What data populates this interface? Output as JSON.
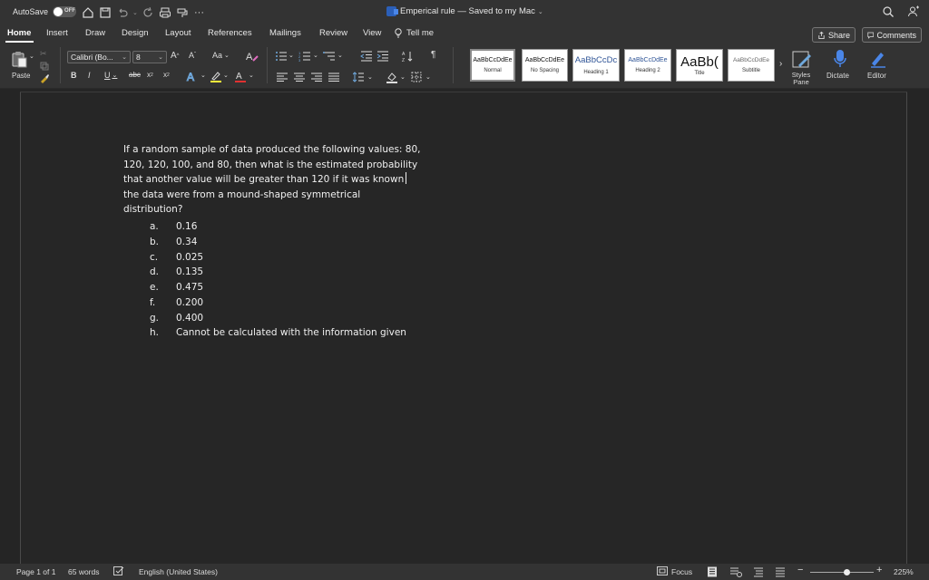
{
  "titlebar": {
    "autosave_label": "AutoSave",
    "autosave_state": "OFF",
    "doc_title": "Emperical rule",
    "doc_status": "— Saved to my Mac"
  },
  "tabs": [
    "Home",
    "Insert",
    "Draw",
    "Design",
    "Layout",
    "References",
    "Mailings",
    "Review",
    "View",
    "Tell me"
  ],
  "active_tab": "Home",
  "share_label": "Share",
  "comments_label": "Comments",
  "ribbon": {
    "paste_label": "Paste",
    "font_name": "Calibri (Bo...",
    "font_size": "8",
    "styles": [
      {
        "sample": "AaBbCcDdEe",
        "name": "Normal"
      },
      {
        "sample": "AaBbCcDdEe",
        "name": "No Spacing"
      },
      {
        "sample": "AaBbCcDc",
        "name": "Heading 1"
      },
      {
        "sample": "AaBbCcDdEe",
        "name": "Heading 2"
      },
      {
        "sample": "AaBb(",
        "name": "Title"
      },
      {
        "sample": "AaBbCcDdEe",
        "name": "Subtitle"
      }
    ],
    "styles_pane_label": "Styles Pane",
    "dictate_label": "Dictate",
    "editor_label": "Editor"
  },
  "document": {
    "question_lines": [
      "If a random sample of data produced the following values: 80,",
      "120, 120, 100, and 80, then what is the estimated probability",
      "that another value will be greater than 120 if it was known",
      "the data were from a mound-shaped symmetrical",
      "distribution?"
    ],
    "options": [
      {
        "letter": "a.",
        "text": "0.16"
      },
      {
        "letter": "b.",
        "text": "0.34"
      },
      {
        "letter": "c.",
        "text": "0.025"
      },
      {
        "letter": "d.",
        "text": "0.135"
      },
      {
        "letter": "e.",
        "text": "0.475"
      },
      {
        "letter": "f.",
        "text": "0.200"
      },
      {
        "letter": "g.",
        "text": "0.400"
      },
      {
        "letter": "h.",
        "text": "Cannot be calculated with the information given"
      }
    ]
  },
  "statusbar": {
    "page": "Page 1 of 1",
    "words": "65 words",
    "language": "English (United States)",
    "focus": "Focus",
    "zoom": "225%"
  },
  "colors": {
    "chrome": "#333333",
    "canvas": "#252525",
    "text": "#f0f0f0",
    "word_blue": "#2b5fb8"
  }
}
